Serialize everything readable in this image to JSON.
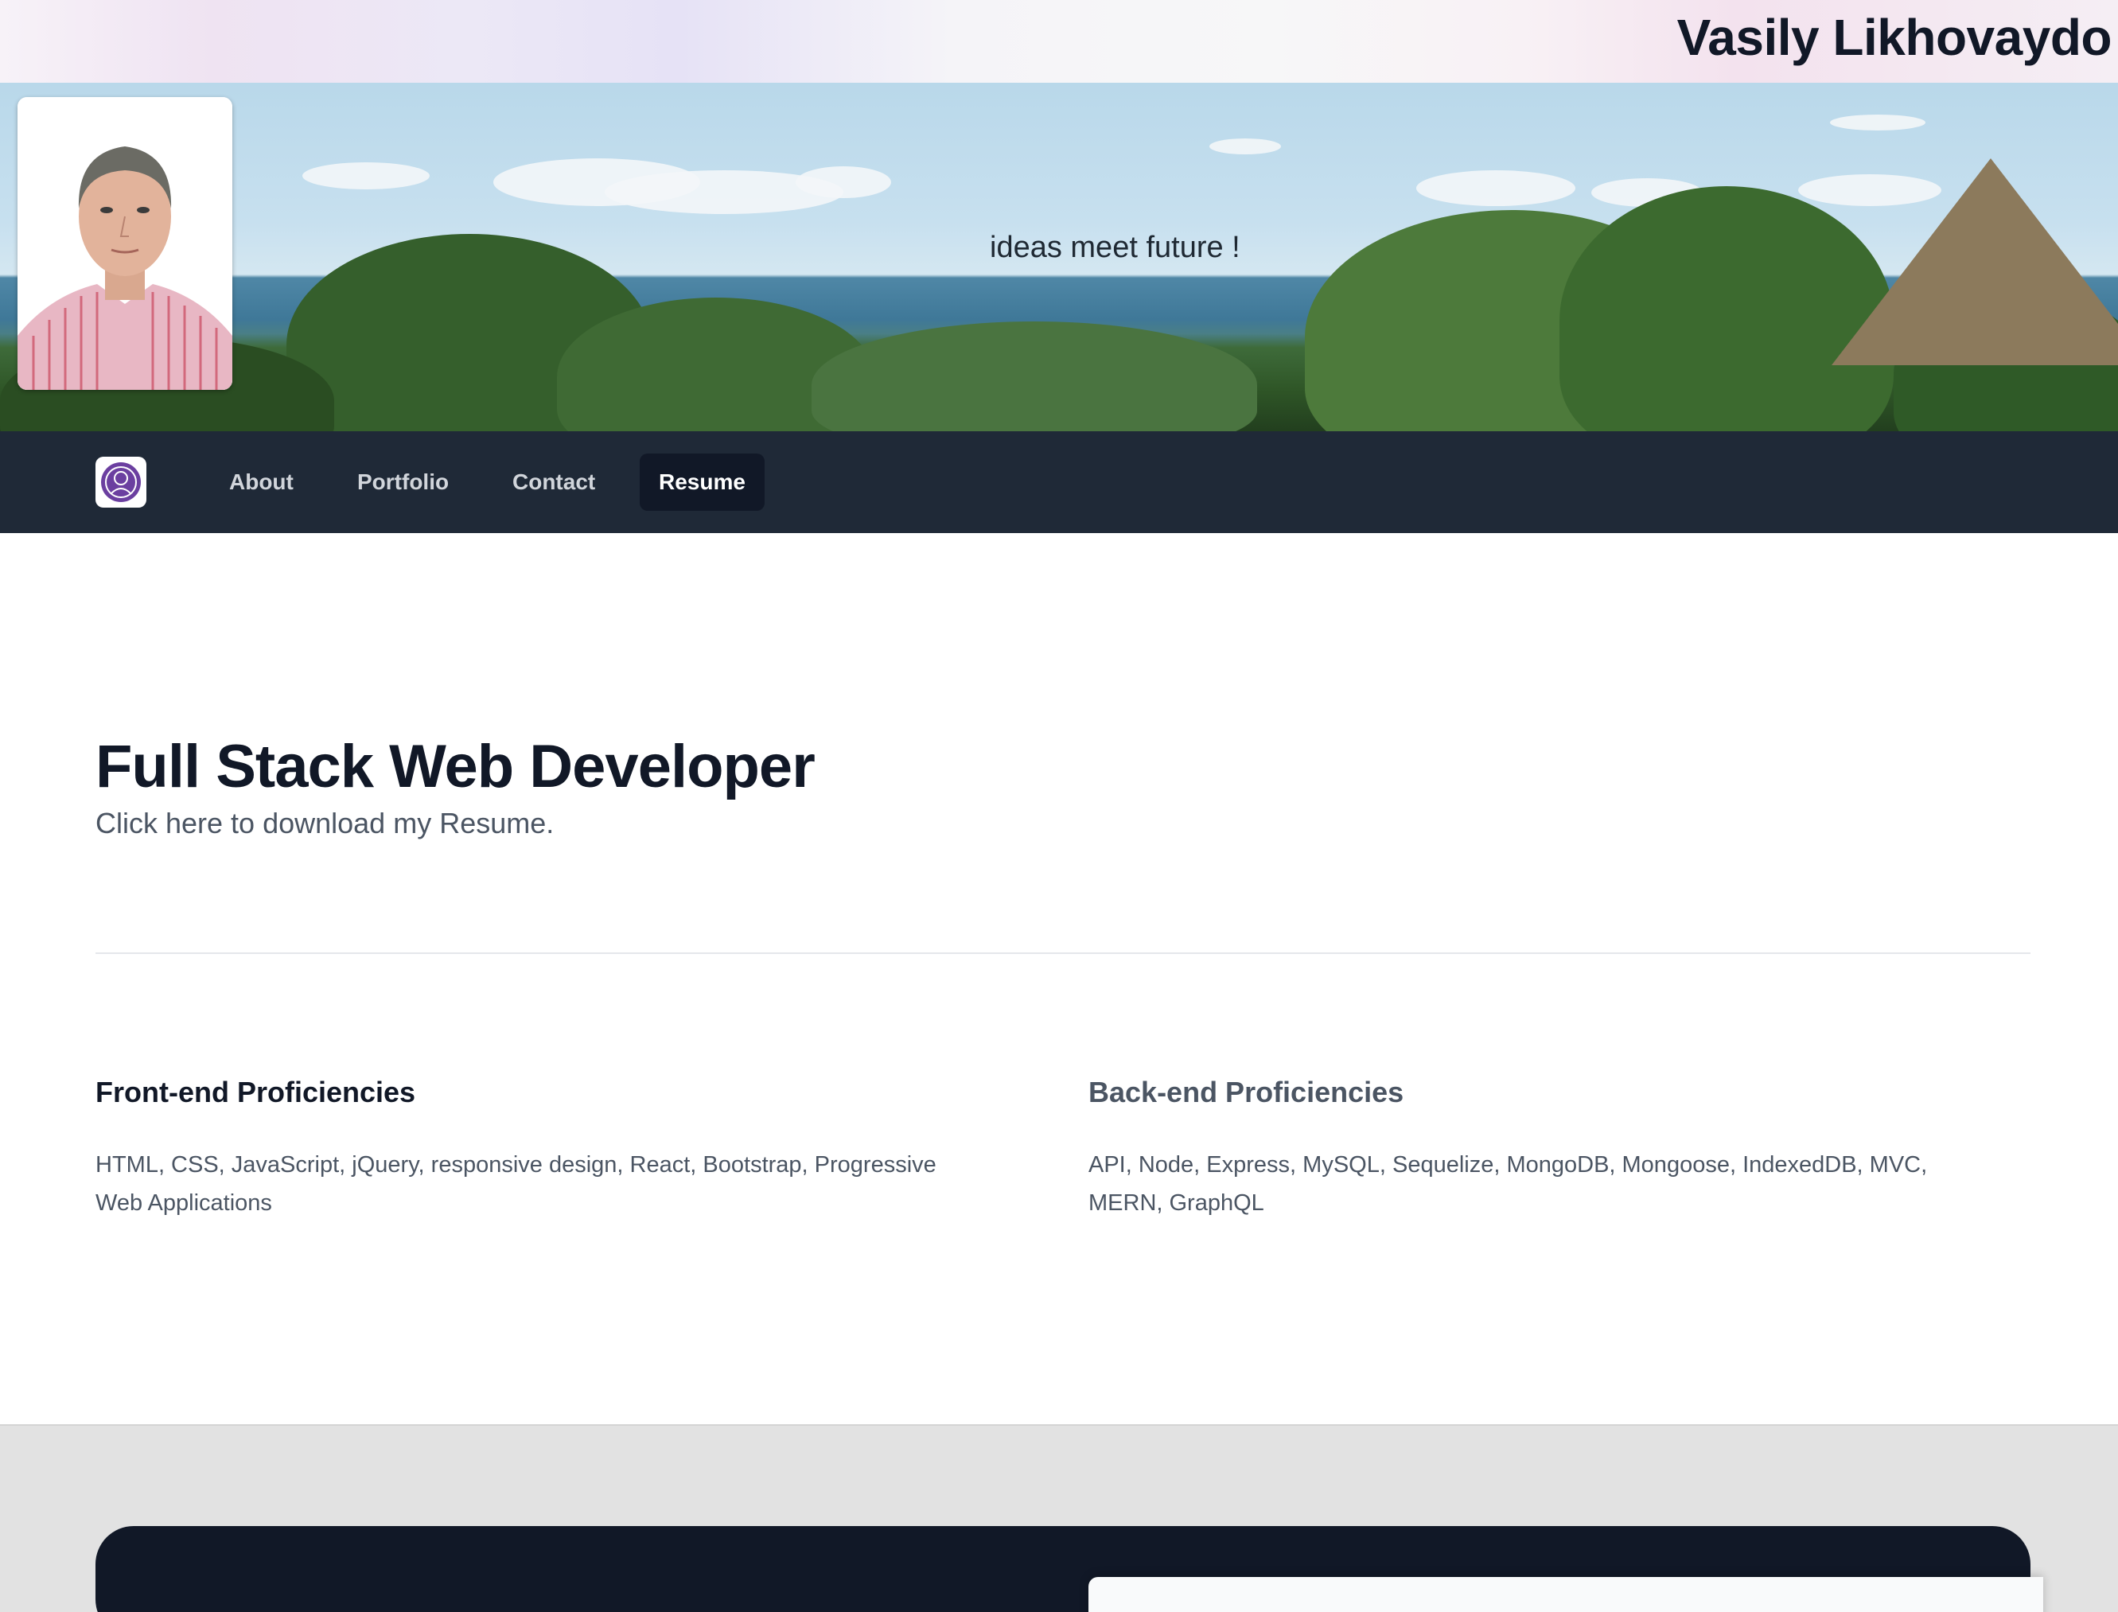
{
  "site": {
    "name": "Vasily Likhovaydo",
    "tagline": "ideas meet future !"
  },
  "nav": {
    "items": [
      {
        "label": "About"
      },
      {
        "label": "Portfolio"
      },
      {
        "label": "Contact"
      },
      {
        "label": "Resume",
        "active": true
      }
    ]
  },
  "resume": {
    "title": "Full Stack Web Developer",
    "download_text": "Click here to download my Resume."
  },
  "proficiencies": {
    "frontend": {
      "title": "Front-end Proficiencies",
      "text": "HTML, CSS, JavaScript, jQuery, responsive design, React, Bootstrap, Progressive Web Applications"
    },
    "backend": {
      "title": "Back-end Proficiencies",
      "text": "API, Node, Express, MySQL, Sequelize, MongoDB, Mongoose, IndexedDB, MVC, MERN, GraphQL"
    }
  },
  "colors": {
    "nav_bg": "#1f2937",
    "nav_active_bg": "#111827",
    "heading": "#111827",
    "muted_text": "#4b5563",
    "footer_bg": "#e2e2e2"
  },
  "icons": {
    "logo": "user-avatar-icon",
    "portrait": "profile-photo"
  }
}
